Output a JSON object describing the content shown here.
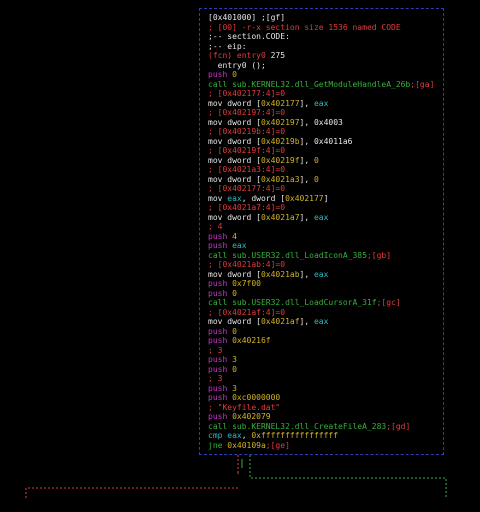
{
  "graph": {
    "node_lines": [
      [
        {
          "t": "[0x401000] ;[gf]",
          "c": "wh"
        }
      ],
      [
        {
          "t": "; [00] -r-x section size 1536 named CODE",
          "c": "rd"
        }
      ],
      [
        {
          "t": ";-- section.CODE:",
          "c": "wh"
        }
      ],
      [
        {
          "t": ";-- eip:",
          "c": "wh"
        }
      ],
      [
        {
          "t": "(fcn) entry0",
          "c": "rd"
        },
        {
          "t": " 275",
          "c": "wh"
        }
      ],
      [
        {
          "t": "  entry0 ();",
          "c": "wh"
        }
      ],
      [
        {
          "t": "push",
          "c": "mg"
        },
        {
          "t": " 0",
          "c": "yl"
        }
      ],
      [
        {
          "t": "call sub.KERNEL32.dll_GetModuleHandleA_26b",
          "c": "gr"
        },
        {
          "t": ";[ga]",
          "c": "rd"
        }
      ],
      [
        {
          "t": "; [0x402177:4]=0",
          "c": "rd"
        }
      ],
      [
        {
          "t": "mov dword [",
          "c": "wh"
        },
        {
          "t": "0x402177",
          "c": "yl"
        },
        {
          "t": "], ",
          "c": "wh"
        },
        {
          "t": "eax",
          "c": "cy"
        }
      ],
      [
        {
          "t": "; [0x402197:4]=0",
          "c": "rd"
        }
      ],
      [
        {
          "t": "mov dword [",
          "c": "wh"
        },
        {
          "t": "0x402197",
          "c": "yl"
        },
        {
          "t": "], 0x4003",
          "c": "wh"
        }
      ],
      [
        {
          "t": "; [0x40219b:4]=0",
          "c": "rd"
        }
      ],
      [
        {
          "t": "mov dword [",
          "c": "wh"
        },
        {
          "t": "0x40219b",
          "c": "yl"
        },
        {
          "t": "], 0x4011a6",
          "c": "wh"
        }
      ],
      [
        {
          "t": "; [0x40219f:4]=0",
          "c": "rd"
        }
      ],
      [
        {
          "t": "mov dword [",
          "c": "wh"
        },
        {
          "t": "0x40219f",
          "c": "yl"
        },
        {
          "t": "], ",
          "c": "wh"
        },
        {
          "t": "0",
          "c": "yl"
        }
      ],
      [
        {
          "t": "; [0x4021a3:4]=0",
          "c": "rd"
        }
      ],
      [
        {
          "t": "mov dword [",
          "c": "wh"
        },
        {
          "t": "0x4021a3",
          "c": "yl"
        },
        {
          "t": "], ",
          "c": "wh"
        },
        {
          "t": "0",
          "c": "yl"
        }
      ],
      [
        {
          "t": "; [0x402177:4]=0",
          "c": "rd"
        }
      ],
      [
        {
          "t": "mov ",
          "c": "wh"
        },
        {
          "t": "eax",
          "c": "cy"
        },
        {
          "t": ", dword [",
          "c": "wh"
        },
        {
          "t": "0x402177",
          "c": "yl"
        },
        {
          "t": "]",
          "c": "wh"
        }
      ],
      [
        {
          "t": "; [0x4021a7:4]=0",
          "c": "rd"
        }
      ],
      [
        {
          "t": "mov dword [",
          "c": "wh"
        },
        {
          "t": "0x4021a7",
          "c": "yl"
        },
        {
          "t": "], ",
          "c": "wh"
        },
        {
          "t": "eax",
          "c": "cy"
        }
      ],
      [
        {
          "t": "; 4",
          "c": "rd"
        }
      ],
      [
        {
          "t": "push",
          "c": "mg"
        },
        {
          "t": " 4",
          "c": "yl"
        }
      ],
      [
        {
          "t": "push",
          "c": "mg"
        },
        {
          "t": " eax",
          "c": "cy"
        }
      ],
      [
        {
          "t": "call sub.USER32.dll_LoadIconA_385",
          "c": "gr"
        },
        {
          "t": ";[gb]",
          "c": "rd"
        }
      ],
      [
        {
          "t": "; [0x4021ab:4]=0",
          "c": "rd"
        }
      ],
      [
        {
          "t": "mov dword [",
          "c": "wh"
        },
        {
          "t": "0x4021ab",
          "c": "yl"
        },
        {
          "t": "], ",
          "c": "wh"
        },
        {
          "t": "eax",
          "c": "cy"
        }
      ],
      [
        {
          "t": "push",
          "c": "mg"
        },
        {
          "t": " 0x7f00",
          "c": "yl"
        }
      ],
      [
        {
          "t": "push",
          "c": "mg"
        },
        {
          "t": " 0",
          "c": "yl"
        }
      ],
      [
        {
          "t": "call sub.USER32.dll_LoadCursorA_31f",
          "c": "gr"
        },
        {
          "t": ";[gc]",
          "c": "rd"
        }
      ],
      [
        {
          "t": "; [0x4021af:4]=0",
          "c": "rd"
        }
      ],
      [
        {
          "t": "mov dword [",
          "c": "wh"
        },
        {
          "t": "0x4021af",
          "c": "yl"
        },
        {
          "t": "], ",
          "c": "wh"
        },
        {
          "t": "eax",
          "c": "cy"
        }
      ],
      [
        {
          "t": "push",
          "c": "mg"
        },
        {
          "t": " 0",
          "c": "yl"
        }
      ],
      [
        {
          "t": "push",
          "c": "mg"
        },
        {
          "t": " 0x40216f",
          "c": "yl"
        }
      ],
      [
        {
          "t": "; 3",
          "c": "rd"
        }
      ],
      [
        {
          "t": "push",
          "c": "mg"
        },
        {
          "t": " 3",
          "c": "yl"
        }
      ],
      [
        {
          "t": "push",
          "c": "mg"
        },
        {
          "t": " 0",
          "c": "yl"
        }
      ],
      [
        {
          "t": "; 3",
          "c": "rd"
        }
      ],
      [
        {
          "t": "push",
          "c": "mg"
        },
        {
          "t": " 3",
          "c": "yl"
        }
      ],
      [
        {
          "t": "push",
          "c": "mg"
        },
        {
          "t": " 0xc0000000",
          "c": "yl"
        }
      ],
      [
        {
          "t": "; \"Keyfile.dat\"",
          "c": "rd"
        }
      ],
      [
        {
          "t": "push",
          "c": "mg"
        },
        {
          "t": " 0x402079",
          "c": "yl"
        }
      ],
      [
        {
          "t": "call sub.KERNEL32.dll_CreateFileA_283",
          "c": "gr"
        },
        {
          "t": ";[gd]",
          "c": "rd"
        }
      ],
      [
        {
          "t": "cmp ",
          "c": "cy"
        },
        {
          "t": "eax",
          "c": "cy"
        },
        {
          "t": ", ",
          "c": "wh"
        },
        {
          "t": "0xffffffffffffffff",
          "c": "yl"
        }
      ],
      [
        {
          "t": "jne ",
          "c": "gr"
        },
        {
          "t": "0x40109a",
          "c": "yl"
        },
        {
          "t": ";[ge]",
          "c": "rd"
        }
      ]
    ],
    "colors": {
      "background": "#000000",
      "node_border": "#2d3fb6",
      "edge_false": "#e23b3b",
      "edge_true": "#35b23a"
    }
  }
}
